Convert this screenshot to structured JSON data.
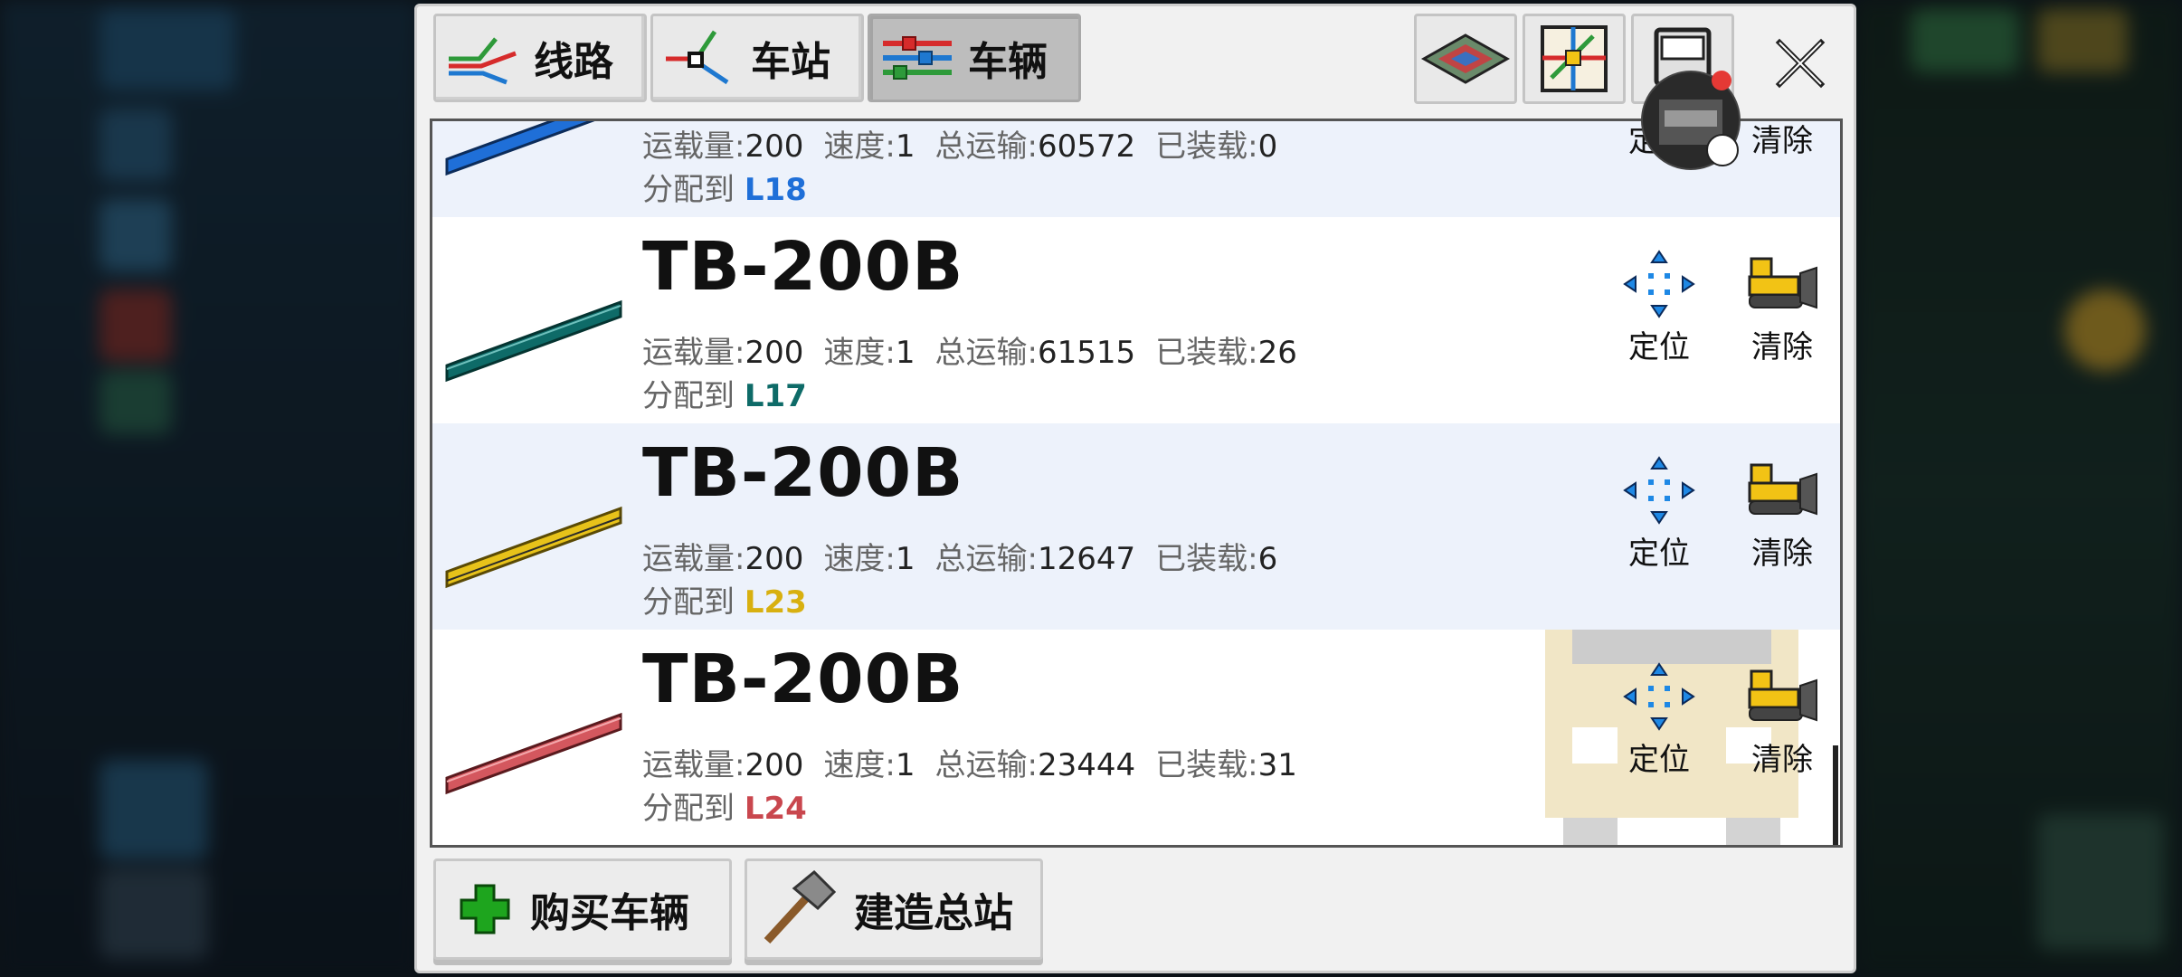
{
  "tabs": [
    {
      "label": "线路",
      "icon": "lines-icon",
      "active": false
    },
    {
      "label": "车站",
      "icon": "station-icon",
      "active": false
    },
    {
      "label": "车辆",
      "icon": "vehicles-icon",
      "active": true
    }
  ],
  "tools": [
    "terrain-map-icon",
    "transit-map-icon",
    "vehicle-stats-icon"
  ],
  "labels": {
    "capacity": "运载量:",
    "speed": "速度:",
    "total": "总运输:",
    "loaded": "已装载:",
    "assigned": "分配到",
    "locate": "定位",
    "clear": "清除"
  },
  "vehicles": [
    {
      "name": "",
      "capacity": "200",
      "speed": "1",
      "total": "60572",
      "loaded": "0",
      "line": "L18",
      "color": "#1f6fd8"
    },
    {
      "name": "TB-200B",
      "capacity": "200",
      "speed": "1",
      "total": "61515",
      "loaded": "26",
      "line": "L17",
      "color": "#0e6b68"
    },
    {
      "name": "TB-200B",
      "capacity": "200",
      "speed": "1",
      "total": "12647",
      "loaded": "6",
      "line": "L23",
      "color": "#e7c21a"
    },
    {
      "name": "TB-200B",
      "capacity": "200",
      "speed": "1",
      "total": "23444",
      "loaded": "31",
      "line": "L24",
      "color": "#d4575e"
    }
  ],
  "buttons": {
    "buy": "购买车辆",
    "build": "建造总站"
  },
  "colors": {
    "panel_bg": "#f1f1f1",
    "row_alt": "#edf2fb",
    "action_icon_blue": "#1e88e5",
    "bulldozer_yellow": "#f2c315",
    "add_green": "#1ea51e"
  }
}
